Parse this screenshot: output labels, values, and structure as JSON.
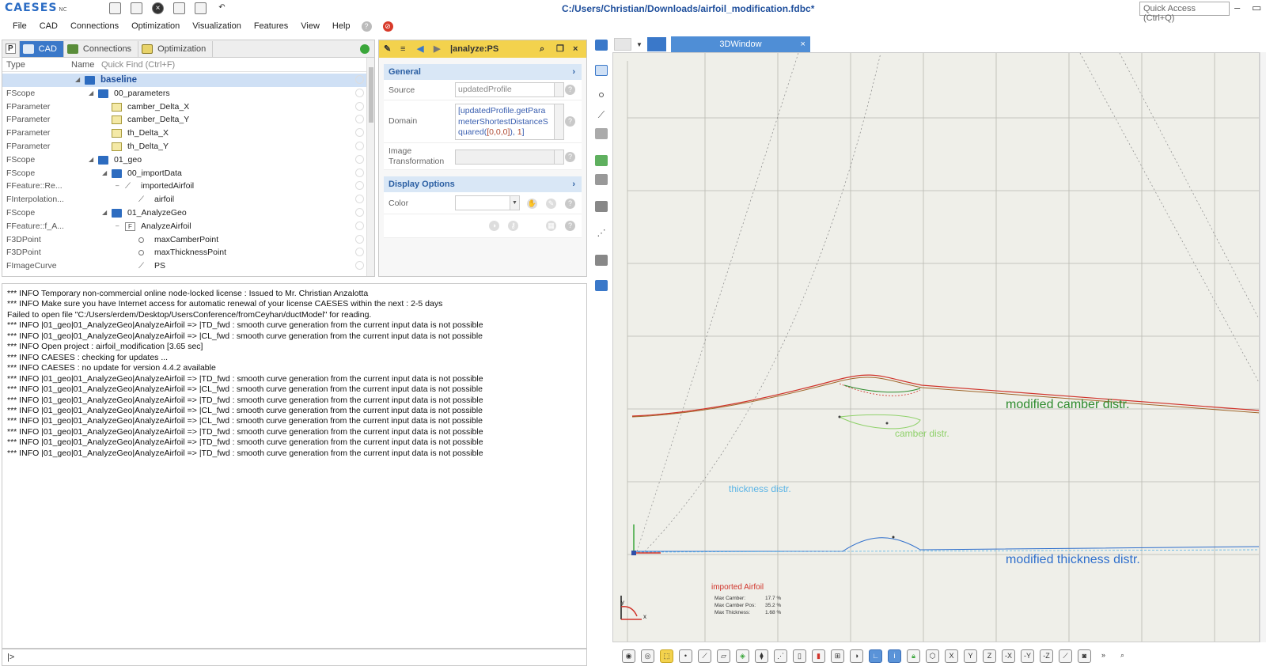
{
  "app": {
    "logo": "CAESES",
    "logo_suffix": "NC",
    "window_title": "C:/Users/Christian/Downloads/airfoil_modification.fdbc*",
    "quick_access_placeholder": "Quick Access (Ctrl+Q)"
  },
  "menu": [
    "File",
    "CAD",
    "Connections",
    "Optimization",
    "Visualization",
    "Features",
    "View",
    "Help"
  ],
  "tree": {
    "tabs": [
      {
        "label": "CAD",
        "active": true
      },
      {
        "label": "Connections",
        "active": false
      },
      {
        "label": "Optimization",
        "active": false
      }
    ],
    "col_type": "Type",
    "col_name": "Name",
    "quick_find_placeholder": "Quick Find (Ctrl+F)",
    "rows": [
      {
        "type": "",
        "name": "baseline",
        "depth": 0,
        "icon": "folder",
        "expander": "◢",
        "selected": true
      },
      {
        "type": "FScope",
        "name": "00_parameters",
        "depth": 1,
        "icon": "folder",
        "expander": "◢"
      },
      {
        "type": "FParameter",
        "name": "camber_Delta_X",
        "depth": 2,
        "icon": "param",
        "expander": ""
      },
      {
        "type": "FParameter",
        "name": "camber_Delta_Y",
        "depth": 2,
        "icon": "param",
        "expander": ""
      },
      {
        "type": "FParameter",
        "name": "th_Delta_X",
        "depth": 2,
        "icon": "param",
        "expander": ""
      },
      {
        "type": "FParameter",
        "name": "th_Delta_Y",
        "depth": 2,
        "icon": "param",
        "expander": ""
      },
      {
        "type": "FScope",
        "name": "01_geo",
        "depth": 1,
        "icon": "folder",
        "expander": "◢"
      },
      {
        "type": "FScope",
        "name": "00_importData",
        "depth": 2,
        "icon": "folder",
        "expander": "◢"
      },
      {
        "type": "FFeature::Re...",
        "name": "importedAirfoil",
        "depth": 3,
        "icon": "curve",
        "expander": "–"
      },
      {
        "type": "FInterpolation...",
        "name": "airfoil",
        "depth": 4,
        "icon": "curve",
        "expander": ""
      },
      {
        "type": "FScope",
        "name": "01_AnalyzeGeo",
        "depth": 2,
        "icon": "folder",
        "expander": "◢"
      },
      {
        "type": "FFeature::f_A...",
        "name": "AnalyzeAirfoil",
        "depth": 3,
        "icon": "feature",
        "expander": "–"
      },
      {
        "type": "F3DPoint",
        "name": "maxCamberPoint",
        "depth": 4,
        "icon": "point",
        "expander": ""
      },
      {
        "type": "F3DPoint",
        "name": "maxThicknessPoint",
        "depth": 4,
        "icon": "point",
        "expander": ""
      },
      {
        "type": "FImageCurve",
        "name": "PS",
        "depth": 4,
        "icon": "curve",
        "expander": ""
      }
    ]
  },
  "props": {
    "title": "|analyze:PS",
    "general_label": "General",
    "source_label": "Source",
    "source_value": "updatedProfile",
    "domain_label": "Domain",
    "domain_text_1": "[updatedProfile.getPara",
    "domain_text_2": "meterShortestDistanceS",
    "domain_text_3": "quared(",
    "domain_tok_1": "[0,0,0]",
    "domain_text_4": "), ",
    "domain_tok_2": "1",
    "domain_text_5": "]",
    "image_transformation_label_1": "Image",
    "image_transformation_label_2": "Transformation",
    "display_label": "Display Options",
    "color_label": "Color"
  },
  "console": {
    "lines": [
      "*** INFO Temporary non-commercial online node-locked license : Issued to Mr. Christian Anzalotta",
      "*** INFO Make sure you have Internet access for automatic renewal of your license CAESES within the next : 2-5 days",
      "Failed to open file \"C:/Users/erdem/Desktop/UsersConference/fromCeyhan/ductModel\" for reading.",
      "*** INFO |01_geo|01_AnalyzeGeo|AnalyzeAirfoil => |TD_fwd : smooth curve generation from the current input data is not possible",
      "*** INFO |01_geo|01_AnalyzeGeo|AnalyzeAirfoil => |CL_fwd : smooth curve generation from the current input data is not possible",
      "*** INFO Open project : airfoil_modification [3.65 sec]",
      "*** INFO CAESES : checking for updates ...",
      "*** INFO CAESES : no update for version 4.4.2 available",
      "*** INFO |01_geo|01_AnalyzeGeo|AnalyzeAirfoil => |TD_fwd : smooth curve generation from the current input data is not possible",
      "*** INFO |01_geo|01_AnalyzeGeo|AnalyzeAirfoil => |CL_fwd : smooth curve generation from the current input data is not possible",
      "*** INFO |01_geo|01_AnalyzeGeo|AnalyzeAirfoil => |TD_fwd : smooth curve generation from the current input data is not possible",
      "*** INFO |01_geo|01_AnalyzeGeo|AnalyzeAirfoil => |CL_fwd : smooth curve generation from the current input data is not possible",
      "*** INFO |01_geo|01_AnalyzeGeo|AnalyzeAirfoil => |CL_fwd : smooth curve generation from the current input data is not possible",
      "*** INFO |01_geo|01_AnalyzeGeo|AnalyzeAirfoil => |TD_fwd : smooth curve generation from the current input data is not possible",
      "*** INFO |01_geo|01_AnalyzeGeo|AnalyzeAirfoil => |TD_fwd : smooth curve generation from the current input data is not possible",
      "*** INFO |01_geo|01_AnalyzeGeo|AnalyzeAirfoil => |TD_fwd : smooth curve generation from the current input data is not possible"
    ],
    "prompt": "|>"
  },
  "view": {
    "tab_label": "3DWindow",
    "label_modified_camber": "modified camber distr.",
    "label_camber": "camber distr.",
    "label_thickness": "thickness distr.",
    "label_modified_thickness": "modified thickness distr.",
    "legend_title": "imported Airfoil",
    "legend_rows": [
      {
        "label": "Max Camber:",
        "value": "17.7 %"
      },
      {
        "label": "Max Camber Pos:",
        "value": "35.2 %"
      },
      {
        "label": "Max Thickness:",
        "value": "1.68 %"
      }
    ],
    "axis_x": "x",
    "axis_y": "y",
    "colors": {
      "camber_modified": "#2e8b2e",
      "camber": "#8fd16a",
      "thickness": "#5ab4e6",
      "thickness_modified": "#2f6fcc",
      "airfoil": "#d0332a"
    }
  }
}
